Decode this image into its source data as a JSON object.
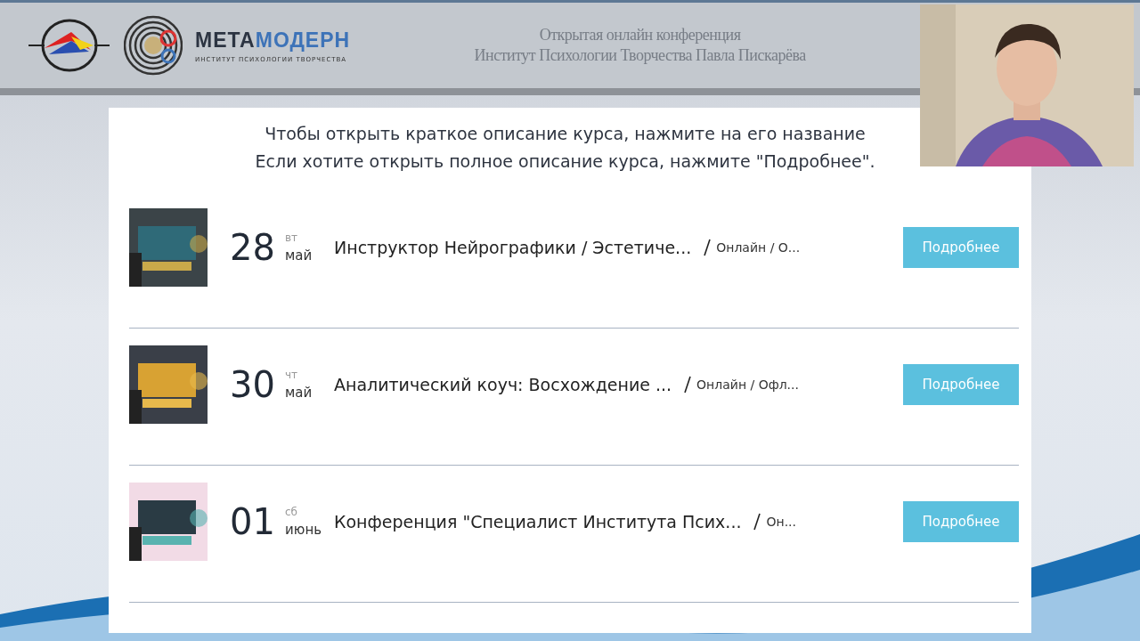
{
  "header": {
    "logo": {
      "wordmark": [
        {
          "text": "МЕТА"
        },
        {
          "text": "МОДЕРН"
        }
      ],
      "tagline": "ИНСТИТУТ ПСИХОЛОГИИ ТВОРЧЕСТВА"
    },
    "title_lines": [
      "Открытая онлайн конференция",
      "Институт Психологии Творчества Павла Пискарёва"
    ]
  },
  "instructions": [
    "Чтобы открыть краткое описание курса, нажмите на его название",
    "Если хотите открыть полное описание курса, нажмите \"Подробнее\"."
  ],
  "courses": [
    {
      "kind": "picture",
      "day": "28",
      "weekday": "вт",
      "month": "май",
      "title": "Инструктор Нейрографики / Эстетиче...",
      "format": "Онлайн / О...",
      "button": "Подробнее"
    },
    {
      "kind": "picture",
      "day": "30",
      "weekday": "чт",
      "month": "май",
      "title": "Аналитический коуч: Восхождение ...",
      "format": "Онлайн / Офл...",
      "button": "Подробнее"
    },
    {
      "kind": "picture",
      "day": "01",
      "weekday": "сб",
      "month": "июнь",
      "title": "Конференция \"Специалист Института Псих...",
      "format": "Он...",
      "button": "Подробнее"
    }
  ],
  "webcam": {
    "kind": "picture"
  }
}
